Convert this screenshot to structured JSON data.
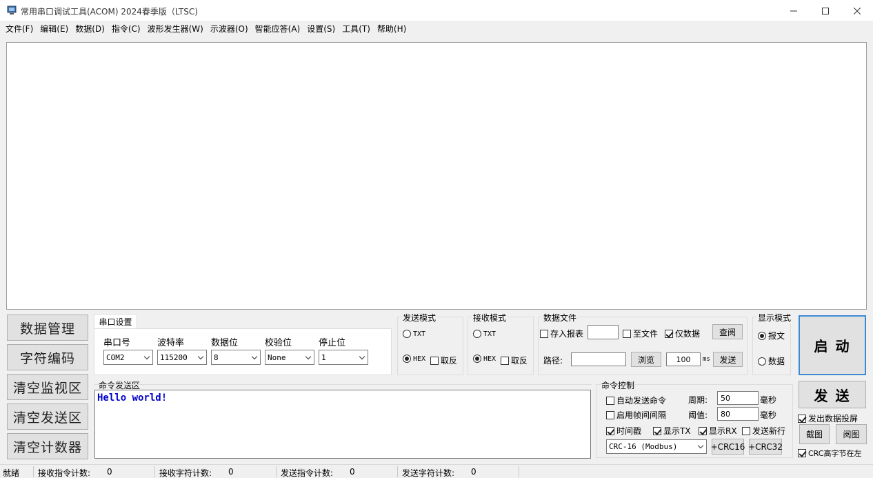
{
  "window": {
    "title": "常用串口调试工具(ACOM) 2024春季版（LTSC)"
  },
  "menu": [
    "文件(F)",
    "编辑(E)",
    "数据(D)",
    "指令(C)",
    "波形发生器(W)",
    "示波器(O)",
    "智能应答(A)",
    "设置(S)",
    "工具(T)",
    "帮助(H)"
  ],
  "left_buttons": [
    "数据管理",
    "字符编码",
    "清空监视区",
    "清空发送区",
    "清空计数器"
  ],
  "serial": {
    "tab": "串口设置",
    "port_label": "串口号",
    "port_value": "COM2",
    "baud_label": "波特率",
    "baud_value": "115200",
    "databits_label": "数据位",
    "databits_value": "8",
    "parity_label": "校验位",
    "parity_value": "None",
    "stopbits_label": "停止位",
    "stopbits_value": "1"
  },
  "send_mode": {
    "title": "发送模式",
    "txt": "TXT",
    "hex": "HEX",
    "invert": "取反",
    "selected": "HEX"
  },
  "recv_mode": {
    "title": "接收模式",
    "txt": "TXT",
    "hex": "HEX",
    "invert": "取反",
    "selected": "HEX"
  },
  "data_file": {
    "title": "数据文件",
    "save_report": "存入报表",
    "to_file": "至文件",
    "data_only": "仅数据",
    "query": "查阅",
    "path_label": "路径:",
    "browse": "浏览",
    "interval_value": "100",
    "interval_unit": "ms",
    "send": "发送",
    "save_report_checked": false,
    "to_file_checked": false,
    "data_only_checked": true
  },
  "display_mode": {
    "title": "显示模式",
    "message": "报文",
    "data": "数据",
    "selected": "报文"
  },
  "start_button": "启 动",
  "send_button": "发 送",
  "cmd_area": {
    "title": "命令发送区",
    "text": "Hello world!"
  },
  "cmd_control": {
    "title": "命令控制",
    "auto_send": "自动发送命令",
    "frame_interval": "启用帧间间隔",
    "period_label": "周期:",
    "period_value": "50",
    "period_unit": "毫秒",
    "threshold_label": "阈值:",
    "threshold_value": "80",
    "threshold_unit": "毫秒",
    "timestamp": "时间戳",
    "show_tx": "显示TX",
    "show_rx": "显示RX",
    "send_newline": "发送新行",
    "timestamp_checked": true,
    "show_tx_checked": true,
    "show_rx_checked": true,
    "send_newline_checked": false,
    "crc_select": "CRC-16 (Modbus)",
    "crc16": "+CRC16",
    "crc32": "+CRC32"
  },
  "right_panel": {
    "send_data_screen": "发出数据投屏",
    "screenshot": "截图",
    "view_image": "阅图",
    "crc_high_left": "CRC高字节在左",
    "send_data_screen_checked": true,
    "crc_high_left_checked": true
  },
  "status": {
    "ready": "就绪",
    "rx_cmd_label": "接收指令计数:",
    "rx_cmd_value": "0",
    "rx_char_label": "接收字符计数:",
    "rx_char_value": "0",
    "tx_cmd_label": "发送指令计数:",
    "tx_cmd_value": "0",
    "tx_char_label": "发送字符计数:",
    "tx_char_value": "0"
  }
}
